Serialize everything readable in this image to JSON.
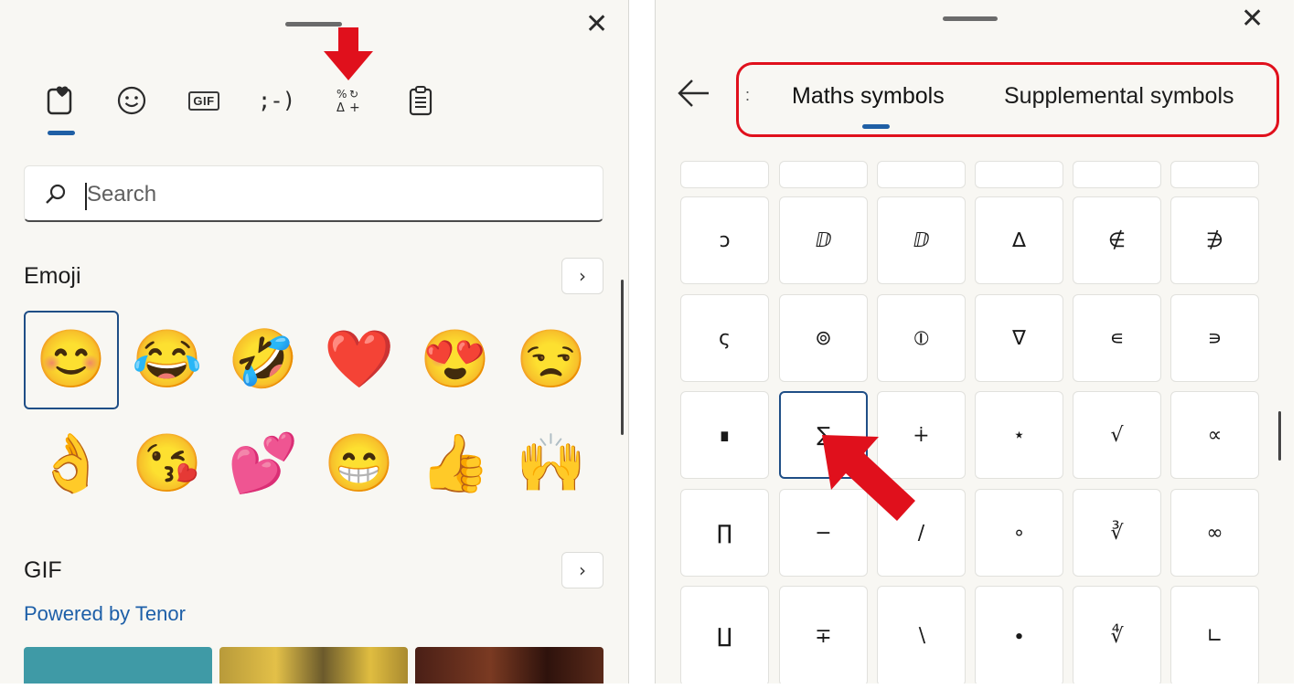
{
  "left_panel": {
    "tabs": [
      {
        "name": "favorites",
        "label": ""
      },
      {
        "name": "emoji",
        "label": "☺"
      },
      {
        "name": "gif",
        "label": "GIF"
      },
      {
        "name": "kaomoji",
        "label": ";-)"
      },
      {
        "name": "symbols",
        "label": "%↻\nΔ+"
      },
      {
        "name": "clipboard",
        "label": ""
      }
    ],
    "search": {
      "placeholder": "Search",
      "value": ""
    },
    "emoji_section": {
      "title": "Emoji",
      "chevron": "›",
      "items": [
        "😊",
        "😂",
        "🤣",
        "❤️",
        "😍",
        "😒",
        "👌",
        "😘",
        "💕",
        "😁",
        "👍",
        "🙌"
      ]
    },
    "gif_section": {
      "title": "GIF",
      "chevron": "›",
      "powered_by": "Powered by Tenor"
    },
    "close_glyph": "✕"
  },
  "right_panel": {
    "close_glyph": "✕",
    "back_glyph": "←",
    "tabs": [
      {
        "label": ":",
        "partial": true
      },
      {
        "label": "Maths symbols",
        "selected": true
      },
      {
        "label": "Supplemental symbols"
      }
    ],
    "grid": {
      "partial_row": [
        "",
        "",
        "",
        "",
        "",
        ""
      ],
      "rows": [
        [
          "ↄ",
          "ⅅ",
          "ⅅ",
          "∆",
          "∉",
          "∌"
        ],
        [
          "ς",
          "⊚",
          "⦶",
          "∇",
          "∊",
          "∍"
        ],
        [
          "∎",
          "∑",
          "∔",
          "⋆",
          "√",
          "∝"
        ],
        [
          "∏",
          "−",
          "∕",
          "∘",
          "∛",
          "∞"
        ],
        [
          "∐",
          "∓",
          "∖",
          "∙",
          "∜",
          "∟"
        ]
      ]
    }
  },
  "annotations": {
    "highlight_color": "#e0101c"
  }
}
